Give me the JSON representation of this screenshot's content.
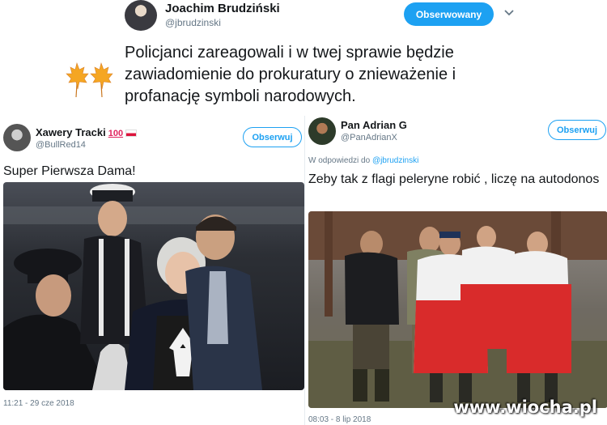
{
  "top_tweet": {
    "name": "Joachim Brudziński",
    "handle": "@jbrudzinski",
    "follow_label": "Obserwowany",
    "chevron": "chevron-down-icon",
    "text": "Policjanci zareagowali i w twej sprawie będzie zawiadomienie do prokuratury o znieważenie i profanację symboli narodowych."
  },
  "left_tweet": {
    "name": "Xawery Tracki",
    "badge": "100",
    "handle": "@BullRed14",
    "follow_label": "Obserwuj",
    "text": "Super Pierwsza Dama!",
    "date": "11:21 - 29 cze 2018"
  },
  "right_tweet": {
    "name": "Pan Adrian G",
    "handle": "@PanAdrianX",
    "follow_label": "Obserwuj",
    "reply_prefix": "W odpowiedzi do",
    "reply_to": "@jbrudzinski",
    "text": "Zeby tak z flagi peleryne robić , liczę na autodonos",
    "date": "08:03 - 8 lip 2018"
  },
  "watermark": "www.wiocha.pl",
  "colors": {
    "accent": "#1da1f2",
    "muted": "#657786",
    "flag_red": "#dc143c"
  }
}
